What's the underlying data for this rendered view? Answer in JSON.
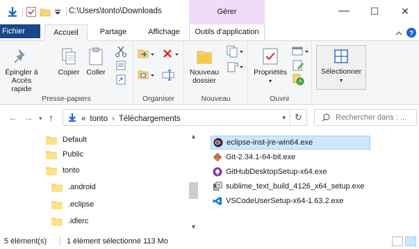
{
  "window": {
    "path": "C:\\Users\\tonto\\Downloads",
    "manage_tab": "Gérer",
    "minimize": "—",
    "maximize": "☐",
    "close": "✕"
  },
  "ribbon_tabs": [
    "Fichier",
    "Accueil",
    "Partage",
    "Affichage",
    "Outils d'application"
  ],
  "ribbon": {
    "pin_label_1": "Épingler à",
    "pin_label_2": "Accès rapide",
    "copy": "Copier",
    "paste": "Coller",
    "group_clipboard": "Presse-papiers",
    "group_organize": "Organiser",
    "new_folder_1": "Nouveau",
    "new_folder_2": "dossier",
    "group_new": "Nouveau",
    "properties": "Propriétés",
    "group_open": "Ouvrir",
    "select": "Sélectionner"
  },
  "address": {
    "prefix": "«",
    "crumbs": [
      "tonto",
      "Téléchargements"
    ],
    "search_placeholder": "Rechercher dans : ..."
  },
  "nav_tree": [
    "Default",
    "Public",
    "tonto",
    ".android",
    ".eclipse",
    ".idlerc"
  ],
  "files": [
    {
      "name": "eclipse-inst-jre-win64.exe",
      "icon": "eclipse-icon",
      "color": "#2c2255"
    },
    {
      "name": "Git-2.34.1-64-bit.exe",
      "icon": "git-icon",
      "color": "#f05133"
    },
    {
      "name": "GitHubDesktopSetup-x64.exe",
      "icon": "github-desktop-icon",
      "color": "#7b3fa8"
    },
    {
      "name": "sublime_text_build_4126_x64_setup.exe",
      "icon": "installer-icon",
      "color": "#3a6fc4"
    },
    {
      "name": "VSCodeUserSetup-x64-1.63.2.exe",
      "icon": "vscode-icon",
      "color": "#0a78d4"
    }
  ],
  "status": {
    "count": "5 élément(s)",
    "selection": "1 élément sélectionné 113 Mo"
  },
  "colors": {
    "accent": "#19478a",
    "manage": "#f0dcf7",
    "selection": "#cce8ff",
    "folder": "#f8d775"
  }
}
